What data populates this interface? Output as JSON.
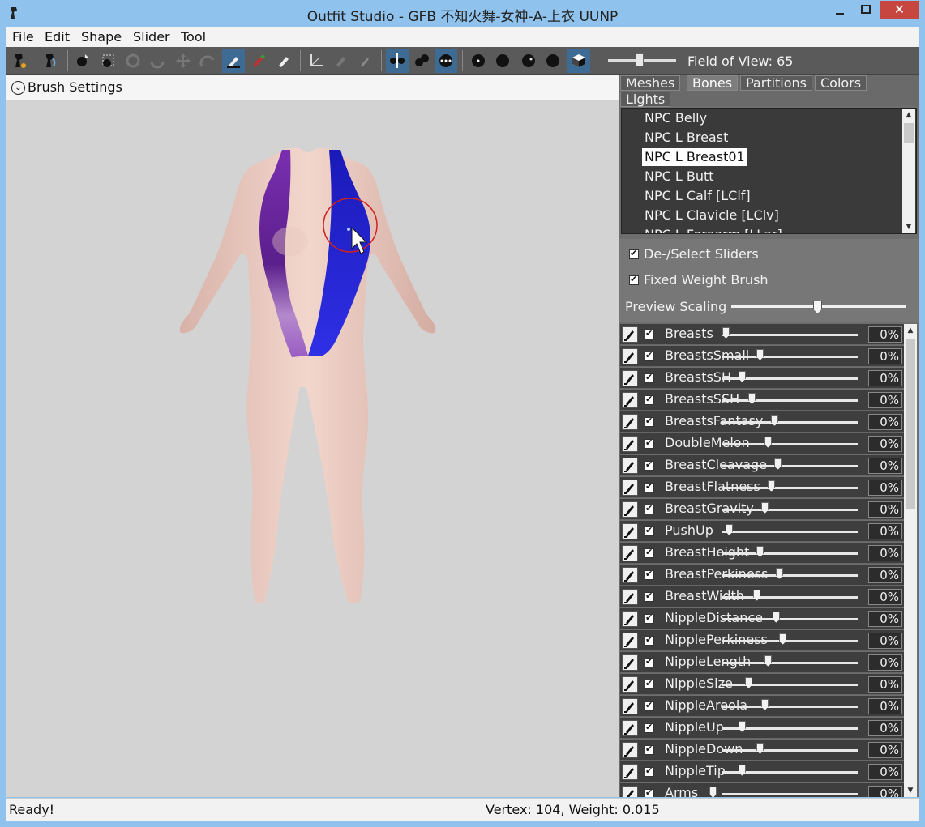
{
  "window": {
    "title": "Outfit Studio - GFB 不知火舞-女神-A-上衣 UUNP",
    "minimize": "▭",
    "maximize": "□",
    "close": "✕"
  },
  "menu": [
    "File",
    "Edit",
    "Shape",
    "Slider",
    "Tool"
  ],
  "toolbar": {
    "field_of_view_label": "Field of View: 65"
  },
  "brush_settings": {
    "label": "Brush Settings"
  },
  "tabs": {
    "meshes": "Meshes",
    "bones": "Bones",
    "partitions": "Partitions",
    "colors": "Colors",
    "lights": "Lights"
  },
  "bones": [
    "NPC Belly",
    "NPC L Breast",
    "NPC L Breast01",
    "NPC L Butt",
    "NPC L Calf [LClf]",
    "NPC L Clavicle [LClv]",
    "NPC L Forearm [LLar]"
  ],
  "selected_bone": "NPC L Breast01",
  "options": {
    "deselect_sliders": "De-/Select Sliders",
    "fixed_weight_brush": "Fixed Weight Brush",
    "preview_scaling": "Preview Scaling"
  },
  "sliders": [
    {
      "name": "Breasts",
      "value": "0%"
    },
    {
      "name": "BreastsSmall",
      "value": "0%"
    },
    {
      "name": "BreastsSH",
      "value": "0%"
    },
    {
      "name": "BreastsSSH",
      "value": "0%"
    },
    {
      "name": "BreastsFantasy",
      "value": "0%"
    },
    {
      "name": "DoubleMelon",
      "value": "0%"
    },
    {
      "name": "BreastCleavage",
      "value": "0%"
    },
    {
      "name": "BreastFlatness",
      "value": "0%"
    },
    {
      "name": "BreastGravity",
      "value": "0%"
    },
    {
      "name": "PushUp",
      "value": "0%"
    },
    {
      "name": "BreastHeight",
      "value": "0%"
    },
    {
      "name": "BreastPerkiness",
      "value": "0%"
    },
    {
      "name": "BreastWidth",
      "value": "0%"
    },
    {
      "name": "NippleDistance",
      "value": "0%"
    },
    {
      "name": "NipplePerkiness",
      "value": "0%"
    },
    {
      "name": "NippleLength",
      "value": "0%"
    },
    {
      "name": "NippleSize",
      "value": "0%"
    },
    {
      "name": "NippleAreola",
      "value": "0%"
    },
    {
      "name": "NippleUp",
      "value": "0%"
    },
    {
      "name": "NippleDown",
      "value": "0%"
    },
    {
      "name": "NippleTip",
      "value": "0%"
    },
    {
      "name": "Arms",
      "value": "0%"
    }
  ],
  "status": {
    "left": "Ready!",
    "right": "Vertex: 104, Weight: 0.015"
  },
  "colors": {
    "title_bar": "#8fc3ee",
    "toolbar": "#5a5a5a",
    "active_tool": "#3d6b94",
    "viewport": "#d3d3d3",
    "close_button": "#c7463f"
  }
}
